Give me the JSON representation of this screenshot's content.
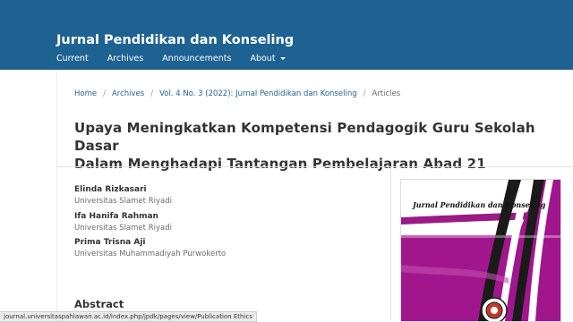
{
  "header": {
    "site_title": "Jurnal Pendidikan dan Konseling",
    "nav": {
      "current": "Current",
      "archives": "Archives",
      "announcements": "Announcements",
      "about": "About"
    }
  },
  "breadcrumb": {
    "home": "Home",
    "archives": "Archives",
    "issue": "Vol. 4 No. 3 (2022): Jurnal Pendidikan dan Konseling",
    "current": "Articles",
    "separator": "/"
  },
  "article": {
    "title_line1": "Upaya Meningkatkan Kompetensi Pendagogik Guru Sekolah Dasar",
    "title_line2": "Dalam Menghadapi Tantangan Pembelajaran Abad 21",
    "authors": [
      {
        "name": "Elinda Rizkasari",
        "affiliation": "Universitas Slamet Riyadi"
      },
      {
        "name": "Ifa Hanifa Rahman",
        "affiliation": "Universitas Slamet Riyadi"
      },
      {
        "name": "Prima Trisna Aji",
        "affiliation": "Universitas Muhammadiyah Purwokerto"
      }
    ],
    "abstract_heading": "Abstract"
  },
  "cover": {
    "title": "Jurnal Pendidikan dan Konseling",
    "logo_icon": "university-seal-icon",
    "colors": {
      "magenta": "#a1168c",
      "black": "#1a1a1a",
      "white": "#ffffff"
    }
  },
  "status_bar": {
    "url": "journal.universitaspahlawan.ac.id/index.php/jpdk/pages/view/Publication Ethics"
  },
  "colors": {
    "header_bg": "#1e6292",
    "link": "#1e6292",
    "text": "#333333",
    "muted": "#6b6b6b"
  }
}
